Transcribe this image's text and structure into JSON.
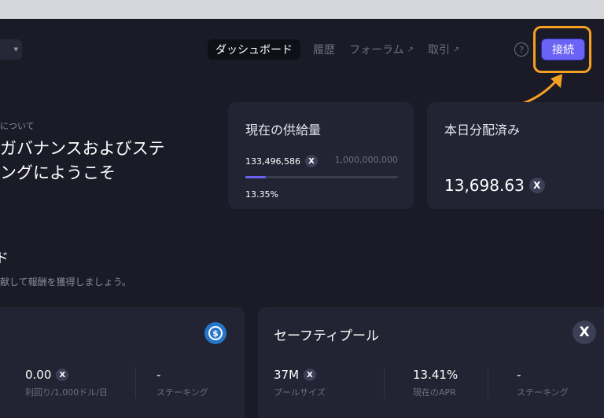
{
  "header": {
    "logo_select_label": "",
    "nav": [
      {
        "label": "ダッシュボード",
        "active": true
      },
      {
        "label": "履歴"
      },
      {
        "label": "フォーラム",
        "external": true
      },
      {
        "label": "取引",
        "external": true
      }
    ],
    "help_symbol": "?",
    "connect_label": "接続"
  },
  "hero": {
    "about": "について",
    "welcome": "ガバナンスおよびステ\nングにようこそ"
  },
  "supply_card": {
    "title": "現在の供給量",
    "current": "133,496,586",
    "max": "1,000,000,000",
    "percent_label": "13.35%",
    "progress": 0.1335
  },
  "distributed_card": {
    "title": "本日分配済み",
    "value": "13,698.63"
  },
  "section": {
    "title": "ド",
    "subtitle": "献して報酬を獲得しましょう。"
  },
  "pool_usdc": {
    "title": "",
    "icon": "usdc-icon",
    "stats": [
      {
        "value": "0.00",
        "label": "利回り/1,000ドル/日",
        "token": true
      },
      {
        "value": "-",
        "label": "ステーキング"
      }
    ]
  },
  "pool_safety": {
    "title": "セーフティプール",
    "icon": "x-token-icon",
    "stats": [
      {
        "value": "37M",
        "label": "プールサイズ",
        "token": true
      },
      {
        "value": "13.41%",
        "label": "現在のAPR"
      },
      {
        "value": "-",
        "label": "ステーキング"
      }
    ]
  },
  "colors": {
    "background": "#1a1b26",
    "card": "#222433",
    "accent": "#6b63f5",
    "highlight": "#f5a023",
    "usdc": "#2775ca"
  }
}
